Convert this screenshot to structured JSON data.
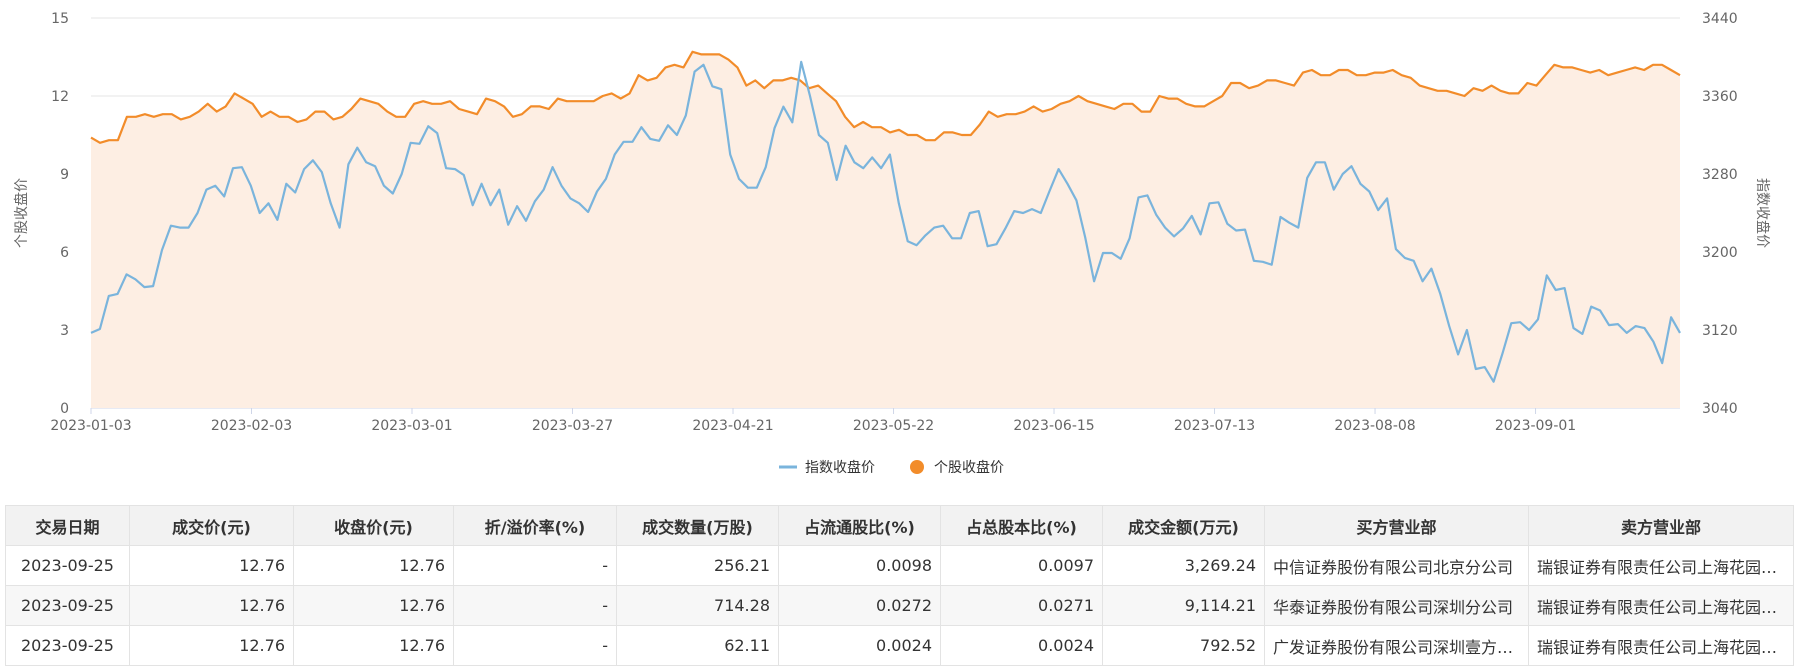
{
  "colors": {
    "index_line": "#7ab4dc",
    "stock_line": "#f28c2a",
    "stock_fill": "#fdeee3",
    "grid": "#e6e6e6",
    "axis": "#cfd6e8"
  },
  "chart_data": {
    "type": "line",
    "x_tick_labels": [
      "2023-01-03",
      "2023-02-03",
      "2023-03-01",
      "2023-03-27",
      "2023-04-21",
      "2023-05-22",
      "2023-06-15",
      "2023-07-13",
      "2023-08-08",
      "2023-09-01"
    ],
    "y_left": {
      "label": "个股收盘价",
      "ticks": [
        "0",
        "3",
        "6",
        "9",
        "12",
        "15"
      ],
      "min": 0,
      "max": 15
    },
    "y_right": {
      "label": "指数收盘价",
      "ticks": [
        "3040",
        "3120",
        "3200",
        "3280",
        "3360",
        "3440"
      ],
      "min": 3040,
      "max": 3440
    },
    "series": [
      {
        "name": "指数收盘价",
        "axis": "right",
        "values": [
          3117,
          3121,
          3155,
          3157,
          3177,
          3172,
          3164,
          3165,
          3202,
          3227,
          3225,
          3225,
          3240,
          3264,
          3268,
          3257,
          3286,
          3287,
          3268,
          3240,
          3250,
          3233,
          3270,
          3261,
          3285,
          3294,
          3282,
          3250,
          3225,
          3290,
          3307,
          3292,
          3288,
          3268,
          3260,
          3280,
          3312,
          3311,
          3329,
          3322,
          3286,
          3285,
          3279,
          3248,
          3270,
          3248,
          3264,
          3228,
          3247,
          3232,
          3252,
          3264,
          3287,
          3268,
          3255,
          3250,
          3241,
          3262,
          3275,
          3300,
          3313,
          3313,
          3328,
          3316,
          3314,
          3330,
          3320,
          3340,
          3385,
          3392,
          3370,
          3367,
          3300,
          3275,
          3266,
          3266,
          3287,
          3327,
          3349,
          3333,
          3395,
          3360,
          3320,
          3312,
          3274,
          3309,
          3292,
          3286,
          3297,
          3286,
          3300,
          3250,
          3211,
          3207,
          3217,
          3225,
          3227,
          3214,
          3214,
          3240,
          3242,
          3206,
          3208,
          3224,
          3242,
          3240,
          3244,
          3240,
          3263,
          3285,
          3270,
          3253,
          3215,
          3170,
          3199,
          3199,
          3193,
          3214,
          3256,
          3258,
          3238,
          3225,
          3216,
          3224,
          3237,
          3218,
          3250,
          3251,
          3229,
          3222,
          3223,
          3191,
          3190,
          3187,
          3236,
          3230,
          3225,
          3276,
          3292,
          3292,
          3264,
          3280,
          3288,
          3270,
          3262,
          3243,
          3255,
          3203,
          3194,
          3191,
          3170,
          3183,
          3157,
          3124,
          3095,
          3120,
          3080,
          3082,
          3067,
          3096,
          3127,
          3128,
          3120,
          3131,
          3176,
          3161,
          3163,
          3122,
          3116,
          3144,
          3140,
          3125,
          3126,
          3117,
          3124,
          3122,
          3108,
          3086,
          3133,
          3117
        ]
      },
      {
        "name": "个股收盘价",
        "axis": "left",
        "values": [
          10.4,
          10.2,
          10.3,
          10.3,
          11.2,
          11.2,
          11.3,
          11.2,
          11.3,
          11.3,
          11.1,
          11.2,
          11.4,
          11.7,
          11.4,
          11.6,
          12.1,
          11.9,
          11.7,
          11.2,
          11.4,
          11.2,
          11.2,
          11.0,
          11.1,
          11.4,
          11.4,
          11.1,
          11.2,
          11.5,
          11.9,
          11.8,
          11.7,
          11.4,
          11.2,
          11.2,
          11.7,
          11.8,
          11.7,
          11.7,
          11.8,
          11.5,
          11.4,
          11.3,
          11.9,
          11.8,
          11.6,
          11.2,
          11.3,
          11.6,
          11.6,
          11.5,
          11.9,
          11.8,
          11.8,
          11.8,
          11.8,
          12.0,
          12.1,
          11.9,
          12.1,
          12.8,
          12.6,
          12.7,
          13.1,
          13.2,
          13.1,
          13.7,
          13.6,
          13.6,
          13.6,
          13.4,
          13.1,
          12.4,
          12.6,
          12.3,
          12.6,
          12.6,
          12.7,
          12.6,
          12.3,
          12.4,
          12.1,
          11.8,
          11.2,
          10.8,
          11.0,
          10.8,
          10.8,
          10.6,
          10.7,
          10.5,
          10.5,
          10.3,
          10.3,
          10.6,
          10.6,
          10.5,
          10.5,
          10.9,
          11.4,
          11.2,
          11.3,
          11.3,
          11.4,
          11.6,
          11.4,
          11.5,
          11.7,
          11.8,
          12.0,
          11.8,
          11.7,
          11.6,
          11.5,
          11.7,
          11.7,
          11.4,
          11.4,
          12.0,
          11.9,
          11.9,
          11.7,
          11.6,
          11.6,
          11.8,
          12.0,
          12.5,
          12.5,
          12.3,
          12.4,
          12.6,
          12.6,
          12.5,
          12.4,
          12.9,
          13.0,
          12.8,
          12.8,
          13.0,
          13.0,
          12.8,
          12.8,
          12.9,
          12.9,
          13.0,
          12.8,
          12.7,
          12.4,
          12.3,
          12.2,
          12.2,
          12.1,
          12.0,
          12.3,
          12.2,
          12.4,
          12.2,
          12.1,
          12.1,
          12.5,
          12.4,
          12.8,
          13.2,
          13.1,
          13.1,
          13.0,
          12.9,
          13.0,
          12.8,
          12.9,
          13.0,
          13.1,
          13.0,
          13.2,
          13.2,
          13.0,
          12.8
        ]
      }
    ],
    "legend": {
      "position": "bottom-center"
    },
    "grid": true
  },
  "table": {
    "headers": [
      "交易日期",
      "成交价(元)",
      "收盘价(元)",
      "折/溢价率(%)",
      "成交数量(万股)",
      "占流通股比(%)",
      "占总股本比(%)",
      "成交金额(万元)",
      "买方营业部",
      "卖方营业部"
    ],
    "rows": [
      [
        "2023-09-25",
        "12.76",
        "12.76",
        "-",
        "256.21",
        "0.0098",
        "0.0097",
        "3,269.24",
        "中信证券股份有限公司北京分公司",
        "瑞银证券有限责任公司上海花园石桥路证券营业部"
      ],
      [
        "2023-09-25",
        "12.76",
        "12.76",
        "-",
        "714.28",
        "0.0272",
        "0.0271",
        "9,114.21",
        "华泰证券股份有限公司深圳分公司",
        "瑞银证券有限责任公司上海花园石桥路证券营业部"
      ],
      [
        "2023-09-25",
        "12.76",
        "12.76",
        "-",
        "62.11",
        "0.0024",
        "0.0024",
        "792.52",
        "广发证券股份有限公司深圳壹方中心证券营业部",
        "瑞银证券有限责任公司上海花园石桥路证券营业部"
      ]
    ]
  }
}
